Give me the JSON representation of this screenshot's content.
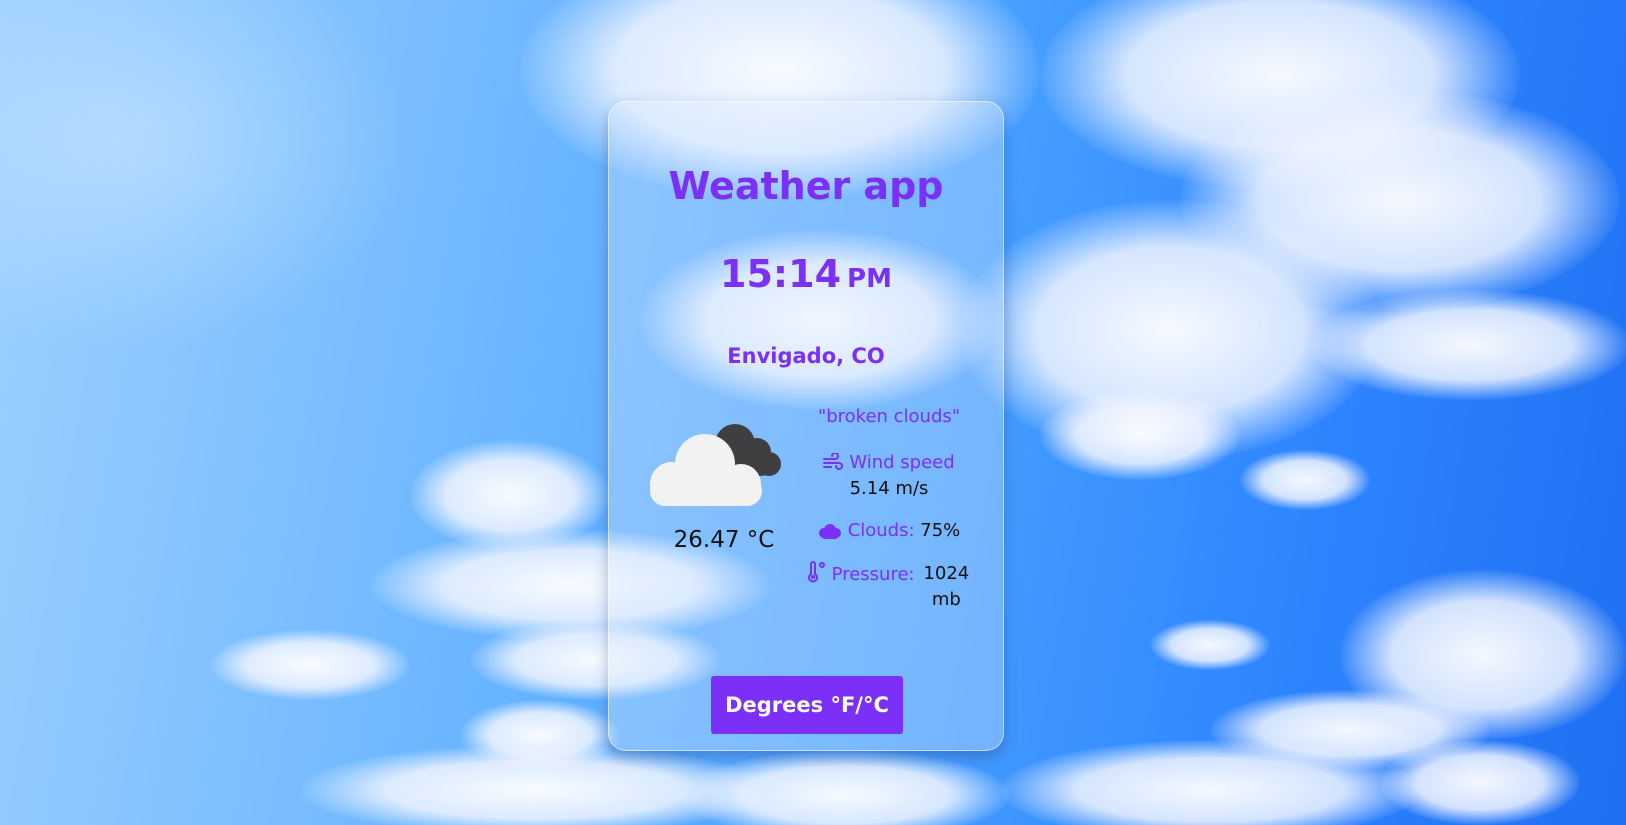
{
  "app": {
    "title": "Weather app"
  },
  "clock": {
    "time": "15:14",
    "period": "PM"
  },
  "location": "Envigado, CO",
  "weather": {
    "icon": "broken-clouds-icon",
    "temperature": "26.47 °C",
    "description": "\"broken clouds\""
  },
  "details": {
    "wind_label": "Wind speed",
    "wind_value": "5.14 m/s",
    "clouds_label": "Clouds:",
    "clouds_value": "75%",
    "pressure_label": "Pressure:",
    "pressure_value": "1024 mb"
  },
  "actions": {
    "toggle_units_label": "Degrees °F/°C"
  },
  "colors": {
    "accent": "#7b2ff7",
    "text": "#111111",
    "button_text": "#ffffff"
  }
}
